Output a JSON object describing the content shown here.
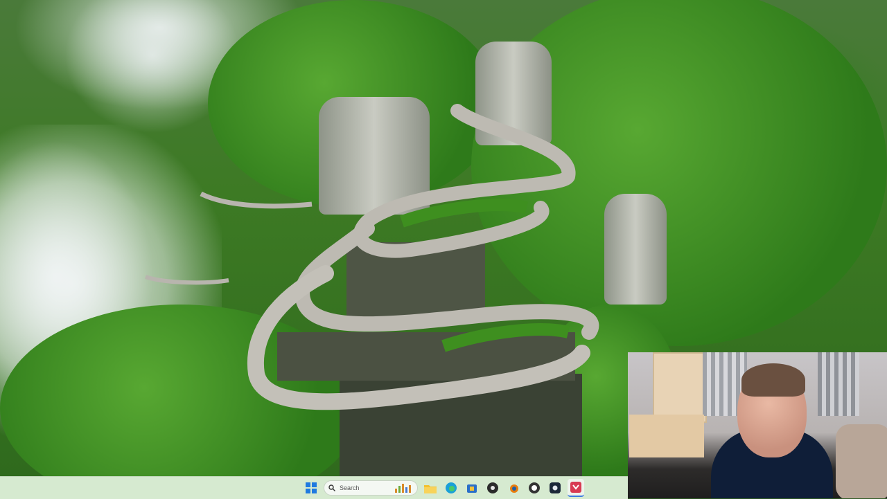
{
  "wallpaper": {
    "description_icon": "mountain-road-wallpaper"
  },
  "taskbar": {
    "search_placeholder": "Search",
    "pinned": [
      {
        "name": "start-button",
        "icon": "windows-logo-icon",
        "color": "#1f7ae0"
      },
      {
        "name": "file-explorer",
        "icon": "folder-icon",
        "color": "#f2c12e"
      },
      {
        "name": "edge-browser",
        "icon": "edge-icon",
        "color": "#1aa0d8"
      },
      {
        "name": "app-store",
        "icon": "store-icon",
        "color": "#2a6fc9"
      },
      {
        "name": "obs-studio",
        "icon": "obs-icon",
        "color": "#2b2b2b"
      },
      {
        "name": "blender",
        "icon": "blender-icon",
        "color": "#e87d0d"
      },
      {
        "name": "epic-games",
        "icon": "epic-icon",
        "color": "#333333"
      },
      {
        "name": "steam",
        "icon": "steam-icon",
        "color": "#1b2838"
      },
      {
        "name": "active-app",
        "icon": "app-red-icon",
        "color": "#d83a52"
      }
    ]
  }
}
